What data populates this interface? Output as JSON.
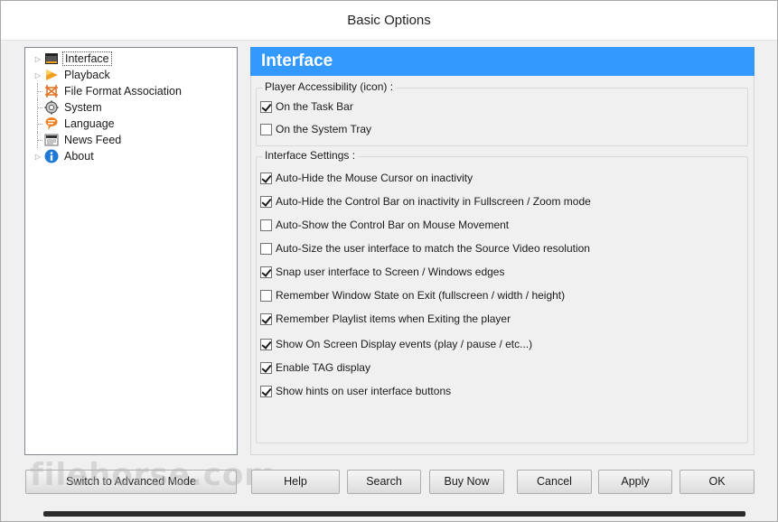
{
  "window": {
    "title": "Basic Options"
  },
  "tree": {
    "items": [
      {
        "label": "Interface",
        "icon": "interface-icon",
        "expandable": true,
        "selected": true
      },
      {
        "label": "Playback",
        "icon": "playback-icon",
        "expandable": true,
        "selected": false
      },
      {
        "label": "File Format Association",
        "icon": "file-association-icon",
        "expandable": false,
        "selected": false
      },
      {
        "label": "System",
        "icon": "gear-icon",
        "expandable": false,
        "selected": false
      },
      {
        "label": "Language",
        "icon": "language-icon",
        "expandable": false,
        "selected": false
      },
      {
        "label": "News Feed",
        "icon": "news-icon",
        "expandable": false,
        "selected": false
      },
      {
        "label": "About",
        "icon": "info-icon",
        "expandable": true,
        "selected": false
      }
    ]
  },
  "panel": {
    "title": "Interface",
    "accessibility": {
      "title": "Player Accessibility (icon) :",
      "options": [
        {
          "label": "On the Task Bar",
          "checked": true
        },
        {
          "label": "On the System Tray",
          "checked": false
        }
      ]
    },
    "settings": {
      "title": "Interface Settings :",
      "options": [
        {
          "label": "Auto-Hide the Mouse Cursor on inactivity",
          "checked": true
        },
        {
          "label": "Auto-Hide the Control Bar on inactivity in Fullscreen / Zoom mode",
          "checked": true
        },
        {
          "label": "Auto-Show the Control Bar on Mouse Movement",
          "checked": false
        },
        {
          "label": "Auto-Size the user interface to match the Source Video resolution",
          "checked": false
        },
        {
          "label": "Snap user interface to Screen / Windows edges",
          "checked": true
        },
        {
          "label": "Remember Window State on Exit (fullscreen / width / height)",
          "checked": false
        },
        {
          "label": "Remember Playlist items when Exiting the player",
          "checked": true
        },
        {
          "label": "Show On Screen Display events (play / pause / etc...)",
          "checked": true
        },
        {
          "label": "Enable TAG display",
          "checked": true
        },
        {
          "label": "Show hints on user interface buttons",
          "checked": true
        }
      ]
    }
  },
  "buttons": {
    "advanced": "Switch to Advanced Mode",
    "help": "Help",
    "search": "Search",
    "buy": "Buy Now",
    "cancel": "Cancel",
    "apply": "Apply",
    "ok": "OK"
  },
  "watermark": "filehorse.com",
  "colors": {
    "banner": "#3399ff",
    "window_bg": "#f0f0f0"
  }
}
